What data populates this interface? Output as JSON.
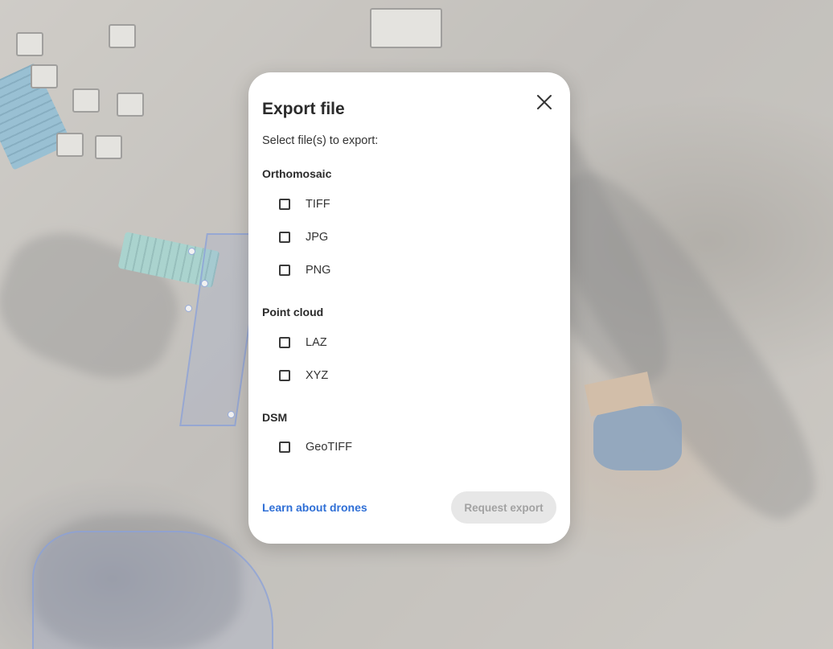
{
  "dialog": {
    "title": "Export file",
    "subtitle": "Select file(s) to export:",
    "close_icon": "close-icon",
    "groups": [
      {
        "label": "Orthomosaic",
        "options": [
          {
            "label": "TIFF",
            "checked": false
          },
          {
            "label": "JPG",
            "checked": false
          },
          {
            "label": "PNG",
            "checked": false
          }
        ]
      },
      {
        "label": "Point cloud",
        "options": [
          {
            "label": "LAZ",
            "checked": false
          },
          {
            "label": "XYZ",
            "checked": false
          }
        ]
      },
      {
        "label": "DSM",
        "options": [
          {
            "label": "GeoTIFF",
            "checked": false
          }
        ]
      }
    ],
    "learn_link": "Learn about drones",
    "export_button": "Request export",
    "export_button_disabled": true
  },
  "colors": {
    "link": "#2f6fd6",
    "disabled_button_bg": "#e7e7e7",
    "disabled_button_text": "#a2a2a2",
    "annotation_outline": "#466ed2"
  }
}
